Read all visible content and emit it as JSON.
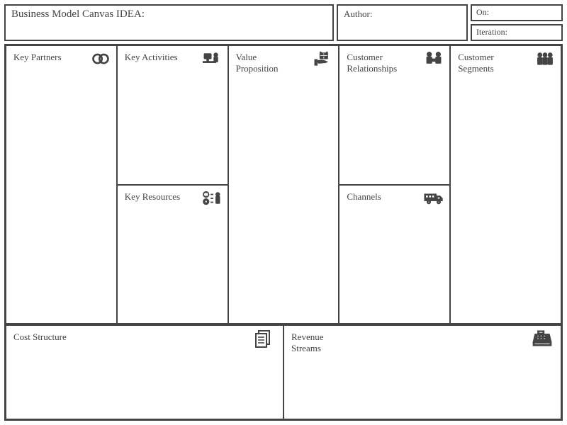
{
  "header": {
    "title_label": "Business Model Canvas IDEA:",
    "author_label": "Author:",
    "on_label": "On:",
    "iteration_label": "Iteration:"
  },
  "blocks": {
    "key_partners": "Key Partners",
    "key_activities": "Key Activities",
    "key_resources": "Key Resources",
    "value_proposition": "Value Proposition",
    "customer_relationships": "Customer Relationships",
    "channels": "Channels",
    "customer_segments": "Customer Segments",
    "cost_structure": "Cost Structure",
    "revenue_streams": "Revenue Streams"
  },
  "values": {
    "title": "",
    "author": "",
    "on": "",
    "iteration": "",
    "key_partners": "",
    "key_activities": "",
    "key_resources": "",
    "value_proposition": "",
    "customer_relationships": "",
    "channels": "",
    "customer_segments": "",
    "cost_structure": "",
    "revenue_streams": ""
  }
}
